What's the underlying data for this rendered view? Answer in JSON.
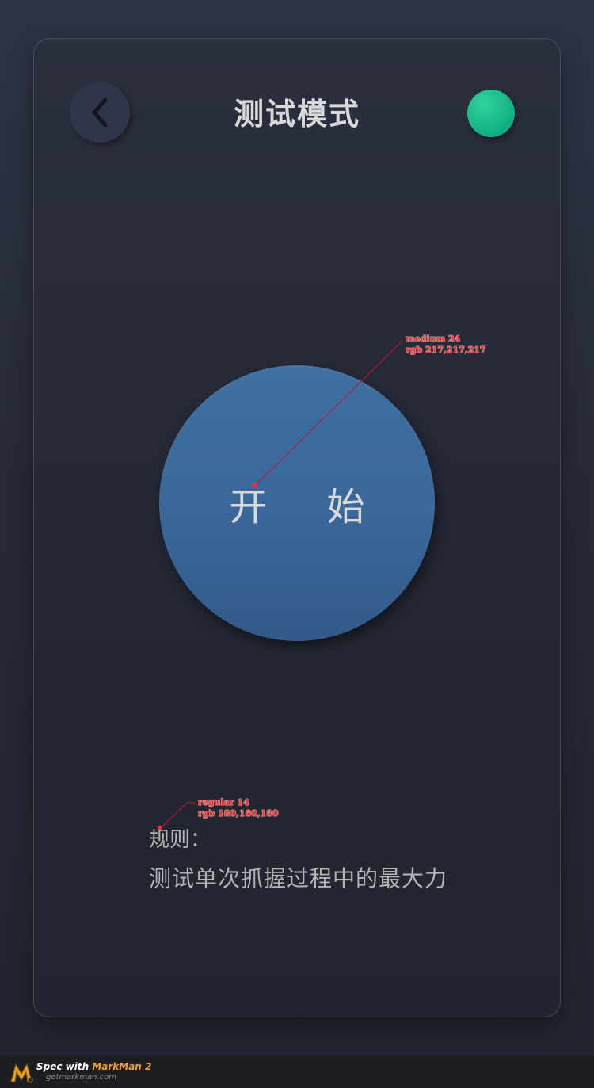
{
  "header": {
    "title": "测试模式",
    "back_icon": "chevron-left-icon",
    "status_color": "#16b487"
  },
  "main": {
    "start_label": "开 始",
    "start_button_color": "#3a679a"
  },
  "rules": {
    "title": "规则：",
    "text": "测试单次抓握过程中的最大力"
  },
  "annotations": {
    "start_font": "medium 24",
    "start_color": "rgb 217,217,217",
    "rules_font": "regular 14",
    "rules_color": "rgb 180,180,180"
  },
  "footer": {
    "spec_prefix": "Spec with ",
    "brand": "MarkMan 2",
    "url": "getmarkman.com"
  }
}
